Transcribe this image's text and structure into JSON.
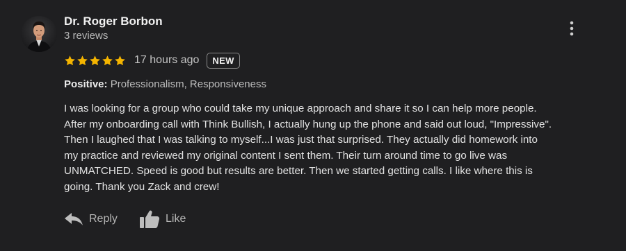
{
  "review": {
    "author": {
      "name": "Dr. Roger Borbon",
      "review_count": "3 reviews",
      "avatar_icon": "user-avatar-photo"
    },
    "rating": {
      "stars": 5,
      "max_stars": 5,
      "star_color": "#f4b400"
    },
    "timestamp": "17 hours ago",
    "badge": "NEW",
    "positive_label": "Positive:",
    "positive_items": "Professionalism, Responsiveness",
    "text": "I was looking for a group who could take my unique approach and  share it so I can help more people.\nAfter my onboarding call with Think Bullish, I actually hung up the phone and said out loud, \"Impressive\".\nThen I laughed that I was talking to myself...I was just that surprised.  They actually did homework into\nmy practice and reviewed my original content I sent them.  Their turn around time to go live was\nUNMATCHED.  Speed is good but results are better.  Then we started getting calls.  I like where this is\ngoing.  Thank you Zack and crew!"
  },
  "actions": {
    "reply_label": "Reply",
    "reply_icon": "reply-arrow-icon",
    "like_label": "Like",
    "like_icon": "thumbs-up-icon"
  },
  "menu": {
    "icon": "more-vertical-icon"
  },
  "colors": {
    "background": "#1f1f21",
    "text": "#e3e3e3",
    "muted": "#b5b5b5",
    "star": "#f4b400"
  }
}
